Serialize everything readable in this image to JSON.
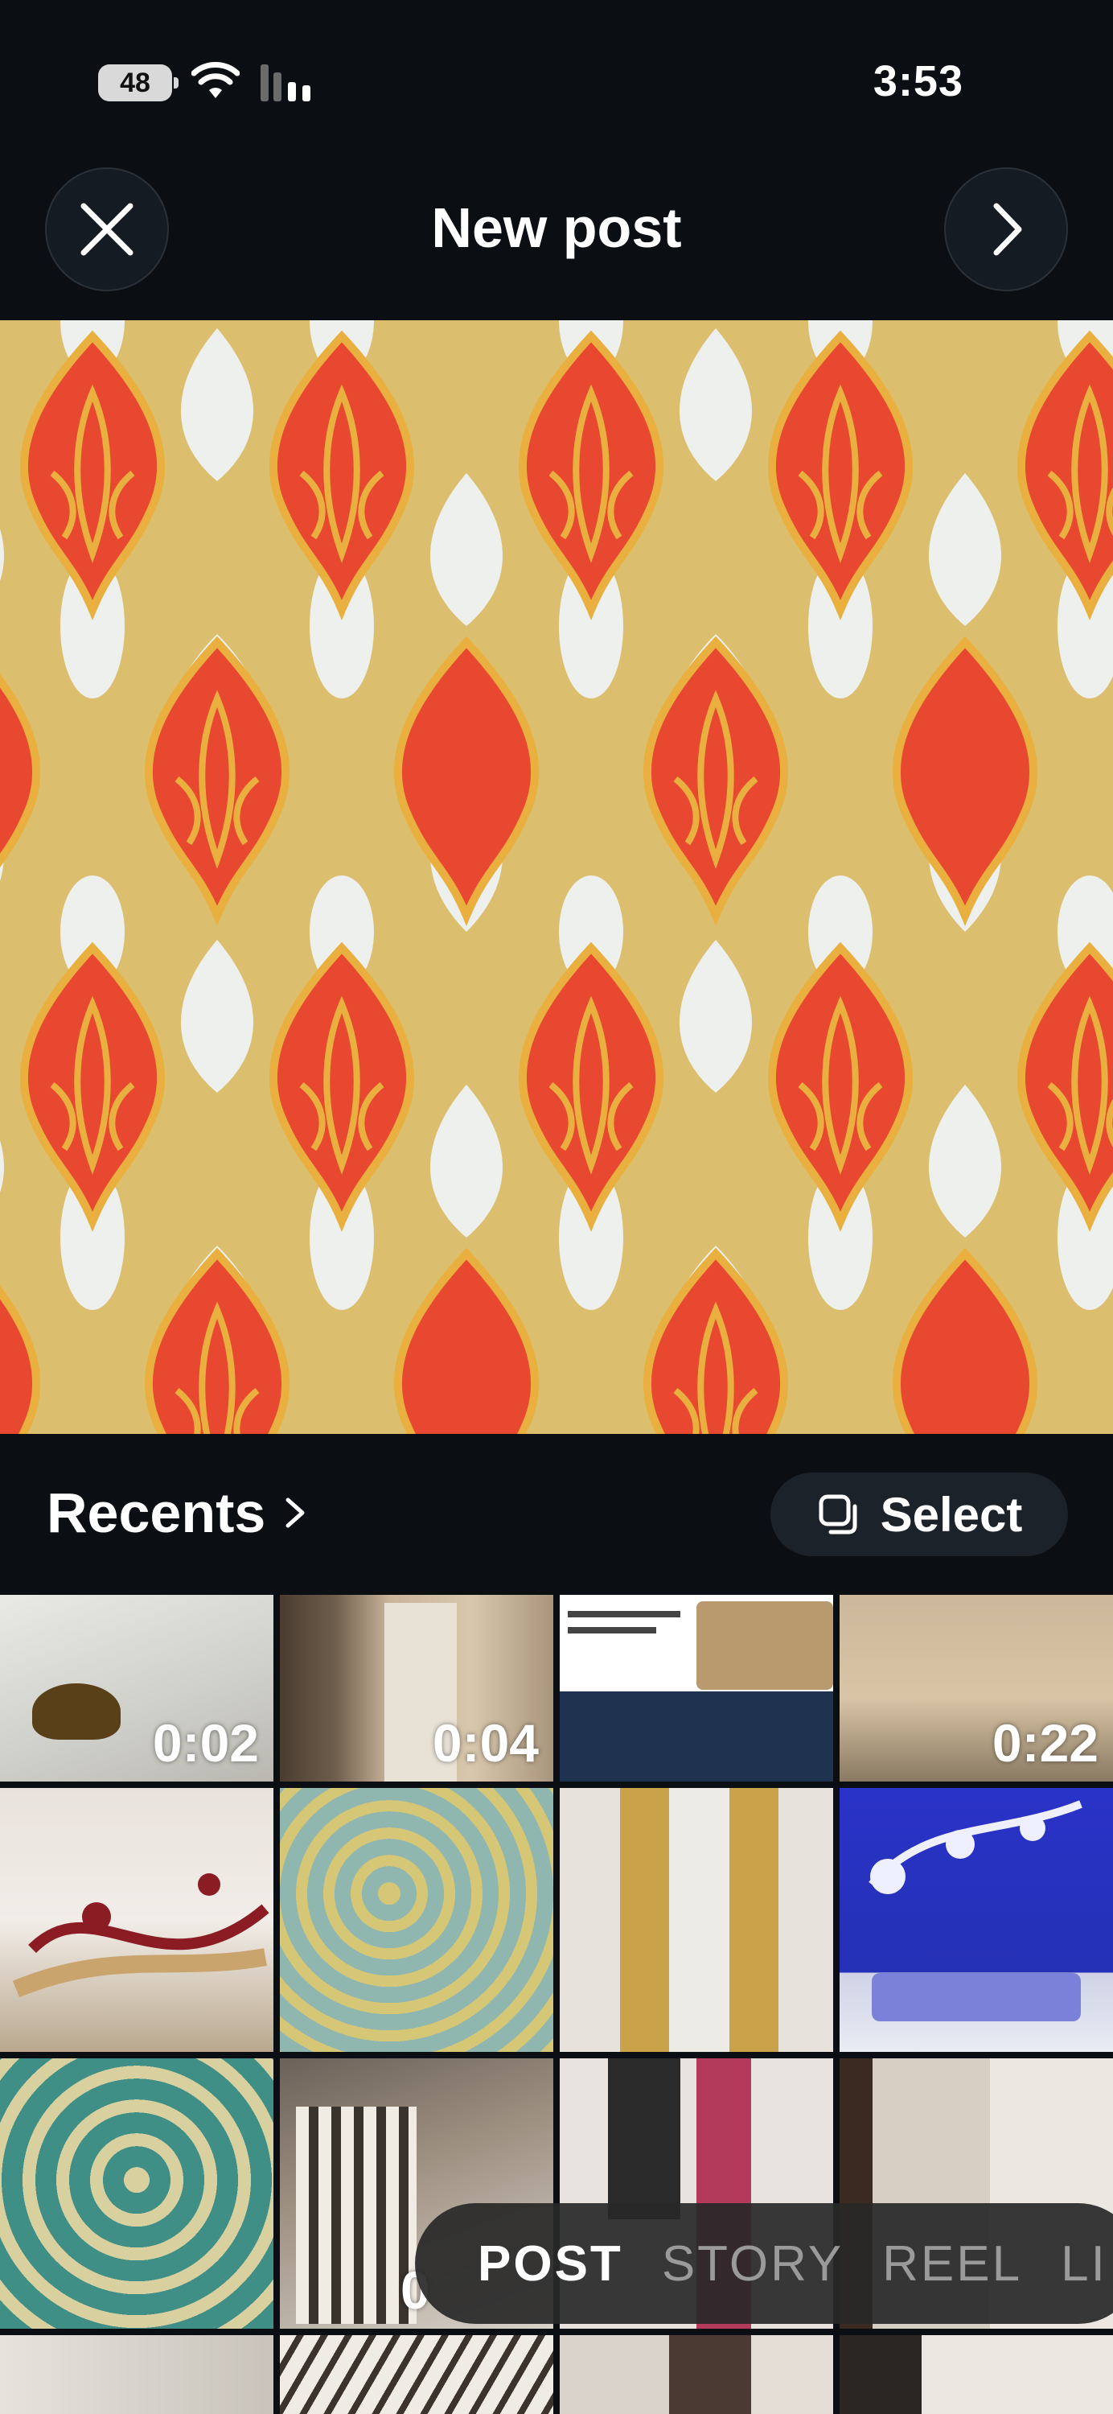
{
  "status_bar": {
    "battery": "48",
    "time": "3:53"
  },
  "header": {
    "title": "New post"
  },
  "album": {
    "label": "Recents"
  },
  "select_button": {
    "label": "Select"
  },
  "grid": [
    {
      "duration": "0:02"
    },
    {
      "duration": "0:04"
    },
    {
      "duration": ""
    },
    {
      "duration": "0:22"
    },
    {
      "duration": ""
    },
    {
      "duration": ""
    },
    {
      "duration": ""
    },
    {
      "duration": ""
    },
    {
      "duration": ""
    },
    {
      "duration": "0"
    },
    {
      "duration": ""
    },
    {
      "duration": ""
    },
    {
      "duration": ""
    },
    {
      "duration": ""
    },
    {
      "duration": ""
    },
    {
      "duration": ""
    }
  ],
  "modes": [
    "POST",
    "STORY",
    "REEL",
    "LI"
  ],
  "colors": {
    "background": "#0b0f14",
    "damask_red": "#e8482f",
    "damask_gold": "#e0b24a",
    "damask_white": "#eef0ee"
  },
  "icons": {
    "close": "close-icon",
    "next": "chevron-right-icon",
    "album_chevron": "chevron-right-icon",
    "select": "multi-select-icon"
  }
}
